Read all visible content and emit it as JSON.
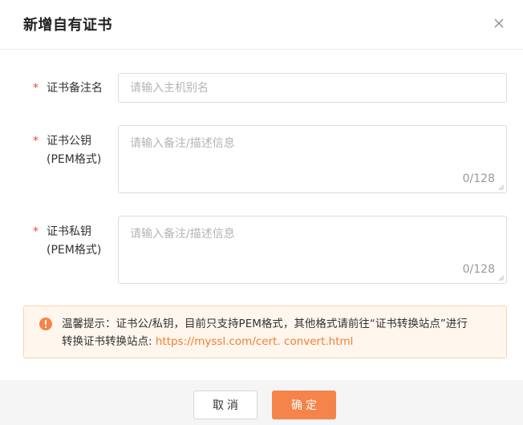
{
  "dialog": {
    "title": "新增自有证书",
    "close_icon": "close-icon"
  },
  "form": {
    "required_mark": "*",
    "alias": {
      "label": "证书备注名",
      "placeholder": "请输入主机别名",
      "value": ""
    },
    "public_key": {
      "label_line1": "证书公钥",
      "label_line2": "(PEM格式)",
      "placeholder": "请输入备注/描述信息",
      "value": "",
      "counter": "0/128"
    },
    "private_key": {
      "label_line1": "证书私钥",
      "label_line2": "(PEM格式)",
      "placeholder": "请输入备注/描述信息",
      "value": "",
      "counter": "0/128"
    }
  },
  "notice": {
    "icon": "info-icon",
    "text_line1": "温馨提示：证书公/私钥，目前只支持PEM格式，其他格式请前往“证书转换站点”进行",
    "text_line2_prefix": "转换证书转换站点: ",
    "link": "https://myssl.com/cert. convert.html"
  },
  "footer": {
    "cancel_label": "取消",
    "ok_label": "确定"
  },
  "colors": {
    "accent": "#f5844b",
    "required": "#f5443b",
    "notice_bg": "#fff6ee",
    "notice_border": "#fbd2b0",
    "link": "#f57e2c"
  }
}
